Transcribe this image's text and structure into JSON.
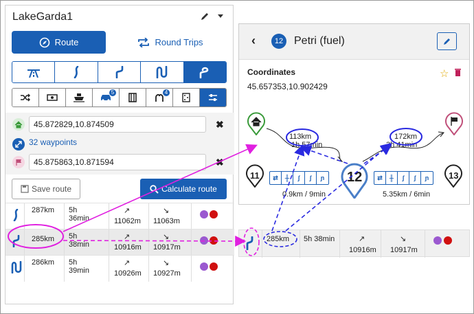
{
  "app": {
    "title": "LakeGarda1"
  },
  "modes": {
    "route_label": "Route",
    "round_label": "Round Trips"
  },
  "route_types": [
    "motorway",
    "winding",
    "curvy",
    "very-curvy",
    "extreme-curvy"
  ],
  "options": [
    {
      "icon": "shuffle-icon"
    },
    {
      "icon": "toll-icon"
    },
    {
      "icon": "ferry-icon"
    },
    {
      "icon": "car-icon",
      "badge": "5"
    },
    {
      "icon": "border-icon"
    },
    {
      "icon": "mountain-pass-icon",
      "badge": "4"
    },
    {
      "icon": "dice-icon"
    },
    {
      "icon": "settings-icon"
    }
  ],
  "waypoints": {
    "start": "45.872829,10.874509",
    "count_label": "32 waypoints",
    "end": "45.875863,10.871594"
  },
  "actions": {
    "save_label": "Save route",
    "calc_label": "Calculate route"
  },
  "routes": [
    {
      "dist": "287km",
      "time": "5h 36min",
      "up": "11062m",
      "down": "11063m"
    },
    {
      "dist": "285km",
      "time": "5h 38min",
      "up": "10916m",
      "down": "10917m"
    },
    {
      "dist": "286km",
      "time": "5h 39min",
      "up": "10926m",
      "down": "10927m"
    }
  ],
  "symbols": {
    "up": "↗",
    "down": "↘"
  },
  "detail": {
    "number": "12",
    "title": "Petri (fuel)",
    "coord_label": "Coordinates",
    "coord_value": "45.657353,10.902429",
    "left_total": "113km",
    "left_time": "1h 57min",
    "right_total": "172km",
    "right_time": "3h 41min",
    "prev_num": "11",
    "next_num": "13",
    "left_leg": "0.9km / 9min",
    "right_leg": "5.35km / 6min"
  },
  "selected_row": {
    "dist": "285km",
    "time": "5h 38min",
    "up": "10916m",
    "down": "10917m"
  },
  "colors": {
    "accent": "#1a5fb4",
    "annotation_magenta": "#e020e0",
    "home_green": "#3a9a3a",
    "finish_pink": "#c0507a",
    "delete_red": "#d01010"
  }
}
